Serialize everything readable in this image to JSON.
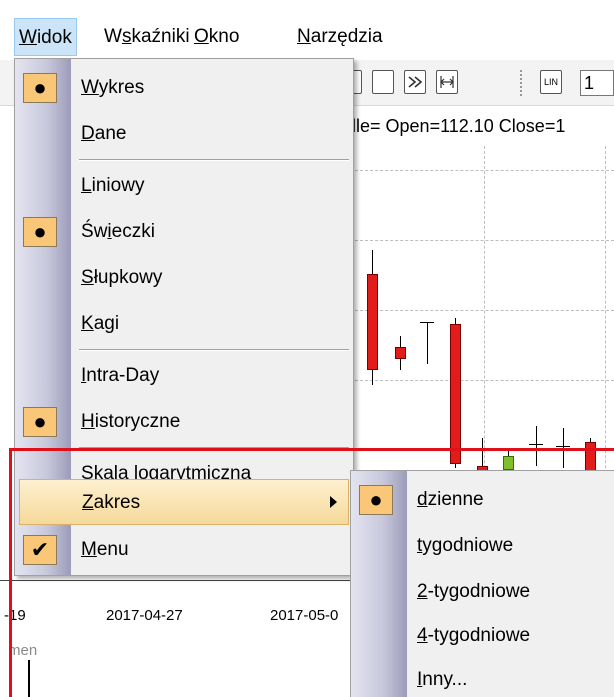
{
  "menubar": {
    "items": [
      {
        "label": "Widok",
        "underline_index": 0,
        "active": true
      },
      {
        "label": "Wskaźniki",
        "underline_index": 1,
        "active": false
      },
      {
        "label": "Okno",
        "underline_index": 0,
        "active": false
      },
      {
        "label": "Narzędzia",
        "underline_index": 0,
        "active": false
      }
    ]
  },
  "chart": {
    "toolbar_input_value": "1",
    "toolbar_lin_label": "LIN",
    "info_text": "dle= Open=112.10 Close=1",
    "x_tick_labels": [
      "-19",
      "2017-04-27",
      "2017-05-0"
    ],
    "lower_label": "men"
  },
  "menu": {
    "items": [
      {
        "label": "Wykres",
        "underline_index": 0,
        "checked": "dot"
      },
      {
        "label": "Dane",
        "underline_index": 0,
        "checked": ""
      },
      {
        "label": "Liniowy",
        "underline_index": 0,
        "checked": ""
      },
      {
        "label": "Świeczki",
        "underline_index": 2,
        "checked": "dot"
      },
      {
        "label": "Słupkowy",
        "underline_index": 0,
        "checked": ""
      },
      {
        "label": "Kagi",
        "underline_index": 0,
        "checked": ""
      },
      {
        "label": "Intra-Day",
        "underline_index": 0,
        "checked": ""
      },
      {
        "label": "Historyczne",
        "underline_index": 0,
        "checked": "dot"
      },
      {
        "label": "Skala logarytmiczna",
        "underline_index": 2,
        "checked": ""
      },
      {
        "label": "Zakres",
        "underline_index": 0,
        "checked": "",
        "highlighted": true,
        "has_submenu": true
      },
      {
        "label": "Menu",
        "underline_index": 0,
        "checked": "tick"
      }
    ]
  },
  "submenu": {
    "items": [
      {
        "label": "dzienne",
        "underline_index": 0,
        "checked": "dot"
      },
      {
        "label": "tygodniowe",
        "underline_index": 0,
        "checked": ""
      },
      {
        "label": "2-tygodniowe",
        "underline_index": 0,
        "checked": ""
      },
      {
        "label": "4-tygodniowe",
        "underline_index": 0,
        "checked": ""
      },
      {
        "label": "Inny...",
        "underline_index": 0,
        "checked": ""
      }
    ]
  },
  "colors": {
    "highlight_frame": "#e0101a",
    "candle_red": "#e21b1b",
    "candle_green": "#7fbf2a",
    "check_bg": "#f9c777"
  }
}
